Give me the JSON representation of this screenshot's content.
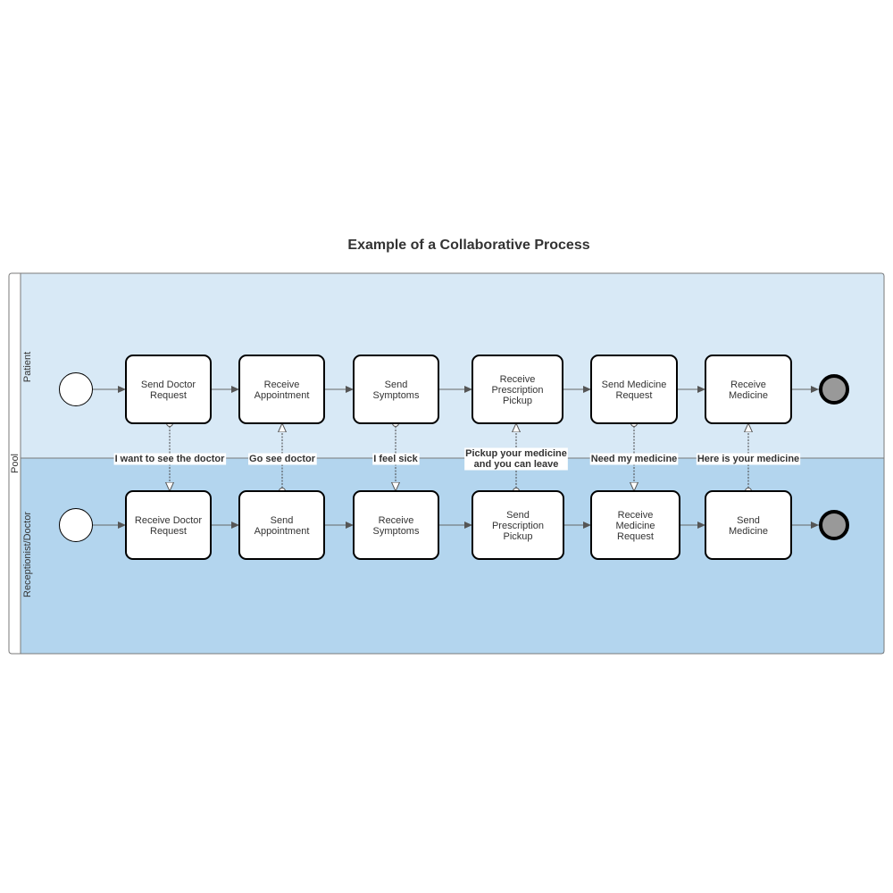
{
  "title": "Example of a Collaborative Process",
  "colors": {
    "lane_top": "#d8e9f6",
    "lane_bottom": "#b3d5ee",
    "border": "#7a7a7a",
    "task_border": "#000000",
    "end_fill": "#999999"
  },
  "pool": {
    "label": "Pool",
    "lanes": [
      {
        "label": "Patient",
        "tasks": [
          "Send Doctor\nRequest",
          "Receive\nAppointment",
          "Send\nSymptoms",
          "Receive\nPrescription\nPickup",
          "Send Medicine\nRequest",
          "Receive\nMedicine"
        ]
      },
      {
        "label": "Receptionist/Doctor",
        "tasks": [
          "Receive Doctor\nRequest",
          "Send\nAppointment",
          "Receive\nSymptoms",
          "Send\nPrescription\nPickup",
          "Receive\nMedicine\nRequest",
          "Send\nMedicine"
        ]
      }
    ]
  },
  "messages": [
    {
      "label": "I want to see the doctor",
      "direction": "down"
    },
    {
      "label": "Go see doctor",
      "direction": "up"
    },
    {
      "label": "I feel sick",
      "direction": "down"
    },
    {
      "label": "Pickup your medicine\nand you can leave",
      "direction": "up"
    },
    {
      "label": "Need my medicine",
      "direction": "down"
    },
    {
      "label": "Here is your medicine",
      "direction": "up"
    }
  ]
}
